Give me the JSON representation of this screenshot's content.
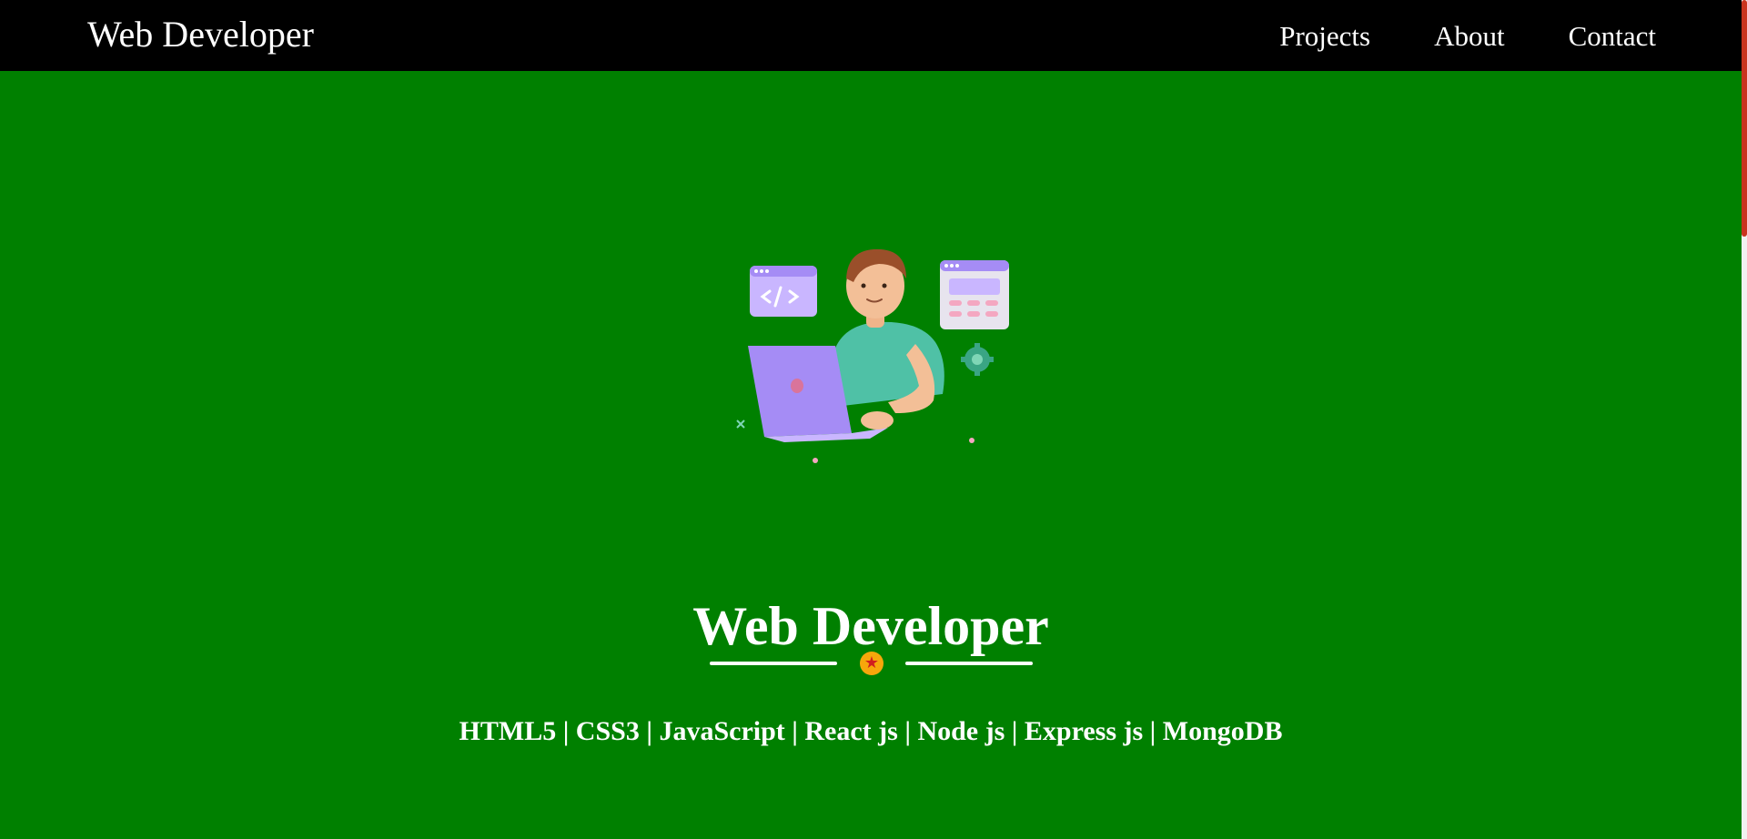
{
  "navbar": {
    "brand": "Web Developer",
    "links": [
      {
        "label": "Projects"
      },
      {
        "label": "About"
      },
      {
        "label": "Contact"
      }
    ]
  },
  "hero": {
    "illustration": "developer-with-laptop-illustration",
    "title": "Web Developer",
    "divider_icon": "star-icon",
    "skills": "HTML5 | CSS3 | JavaScript | React js | Node js | Express js | MongoDB"
  },
  "colors": {
    "page_background": "#008000",
    "navbar_background": "#000000",
    "text": "#ffffff",
    "scrollbar_thumb": "#c9341f",
    "star_badge": "#f7a70b"
  }
}
